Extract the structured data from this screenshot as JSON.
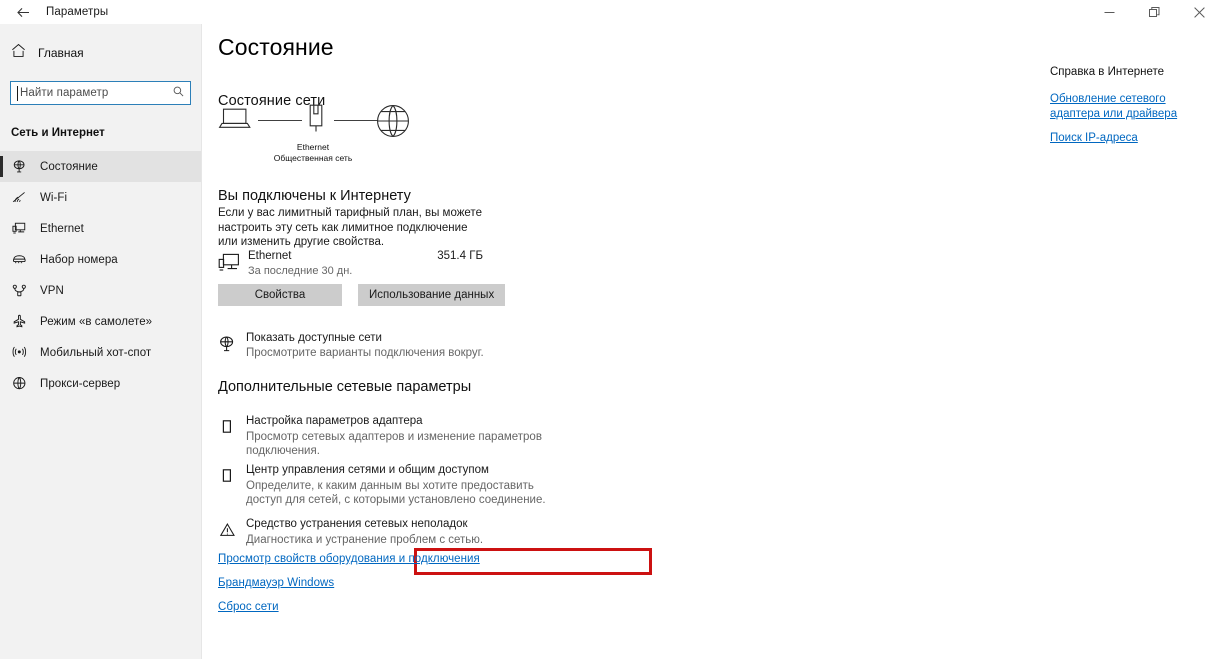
{
  "titlebar": {
    "back_icon": "arrow-left-icon",
    "title": "Параметры",
    "minimize_icon": "minimize-icon",
    "restore_icon": "restore-icon",
    "close_icon": "close-icon"
  },
  "sidebar": {
    "home": {
      "icon": "home-icon",
      "label": "Главная"
    },
    "search": {
      "placeholder": "Найти параметр",
      "value": "",
      "icon": "search-icon"
    },
    "section_header": "Сеть и Интернет",
    "items": [
      {
        "label": "Состояние",
        "icon": "globe-status-icon",
        "selected": true
      },
      {
        "label": "Wi-Fi",
        "icon": "wifi-icon",
        "selected": false
      },
      {
        "label": "Ethernet",
        "icon": "ethernet-icon",
        "selected": false
      },
      {
        "label": "Набор номера",
        "icon": "dialup-modem-icon",
        "selected": false
      },
      {
        "label": "VPN",
        "icon": "vpn-icon",
        "selected": false
      },
      {
        "label": "Режим «в самолете»",
        "icon": "airplane-icon",
        "selected": false
      },
      {
        "label": "Мобильный хот-спот",
        "icon": "hotspot-icon",
        "selected": false
      },
      {
        "label": "Прокси-сервер",
        "icon": "proxy-globe-icon",
        "selected": false
      }
    ]
  },
  "main": {
    "page_title": "Состояние",
    "network_status_heading": "Состояние сети",
    "diagram": {
      "device_icon": "laptop-icon",
      "adapter_icon": "network-adapter-icon",
      "internet_icon": "globe-icon",
      "caption_line1": "Ethernet",
      "caption_line2": "Общественная сеть"
    },
    "connected_title": "Вы подключены к Интернету",
    "connected_desc": "Если у вас лимитный тарифный план, вы можете настроить эту сеть как лимитное подключение или изменить другие свойства.",
    "usage": {
      "icon": "ethernet-monitor-icon",
      "name": "Ethernet",
      "subtitle": "За последние 30 дн.",
      "amount": "351.4 ГБ"
    },
    "buttons": [
      {
        "label": "Свойства"
      },
      {
        "label": "Использование данных"
      }
    ],
    "show_networks": {
      "icon": "globe-status-icon",
      "title": "Показать доступные сети",
      "subtitle": "Просмотрите варианты подключения вокруг."
    },
    "advanced_heading": "Дополнительные сетевые параметры",
    "advanced_items": [
      {
        "icon": "adapter-options-icon",
        "title": "Настройка параметров адаптера",
        "subtitle": "Просмотр сетевых адаптеров и изменение параметров подключения."
      },
      {
        "icon": "sharing-center-icon",
        "title": "Центр управления сетями и общим доступом",
        "subtitle": "Определите, к каким данным вы хотите предоставить доступ для сетей, с которыми установлено соединение."
      },
      {
        "icon": "troubleshoot-warning-icon",
        "title": "Средство устранения сетевых неполадок",
        "subtitle": "Диагностика и устранение проблем с сетью."
      }
    ],
    "links": [
      {
        "label": "Просмотр свойств оборудования и подключения",
        "highlighted": true
      },
      {
        "label": "Брандмауэр Windows",
        "highlighted": false
      },
      {
        "label": "Сброс сети",
        "highlighted": false
      }
    ],
    "highlight_color": "#cc1111"
  },
  "help_panel": {
    "title": "Справка в Интернете",
    "links": [
      "Обновление сетевого адаптера или драйвера",
      "Поиск IP-адреса"
    ]
  }
}
